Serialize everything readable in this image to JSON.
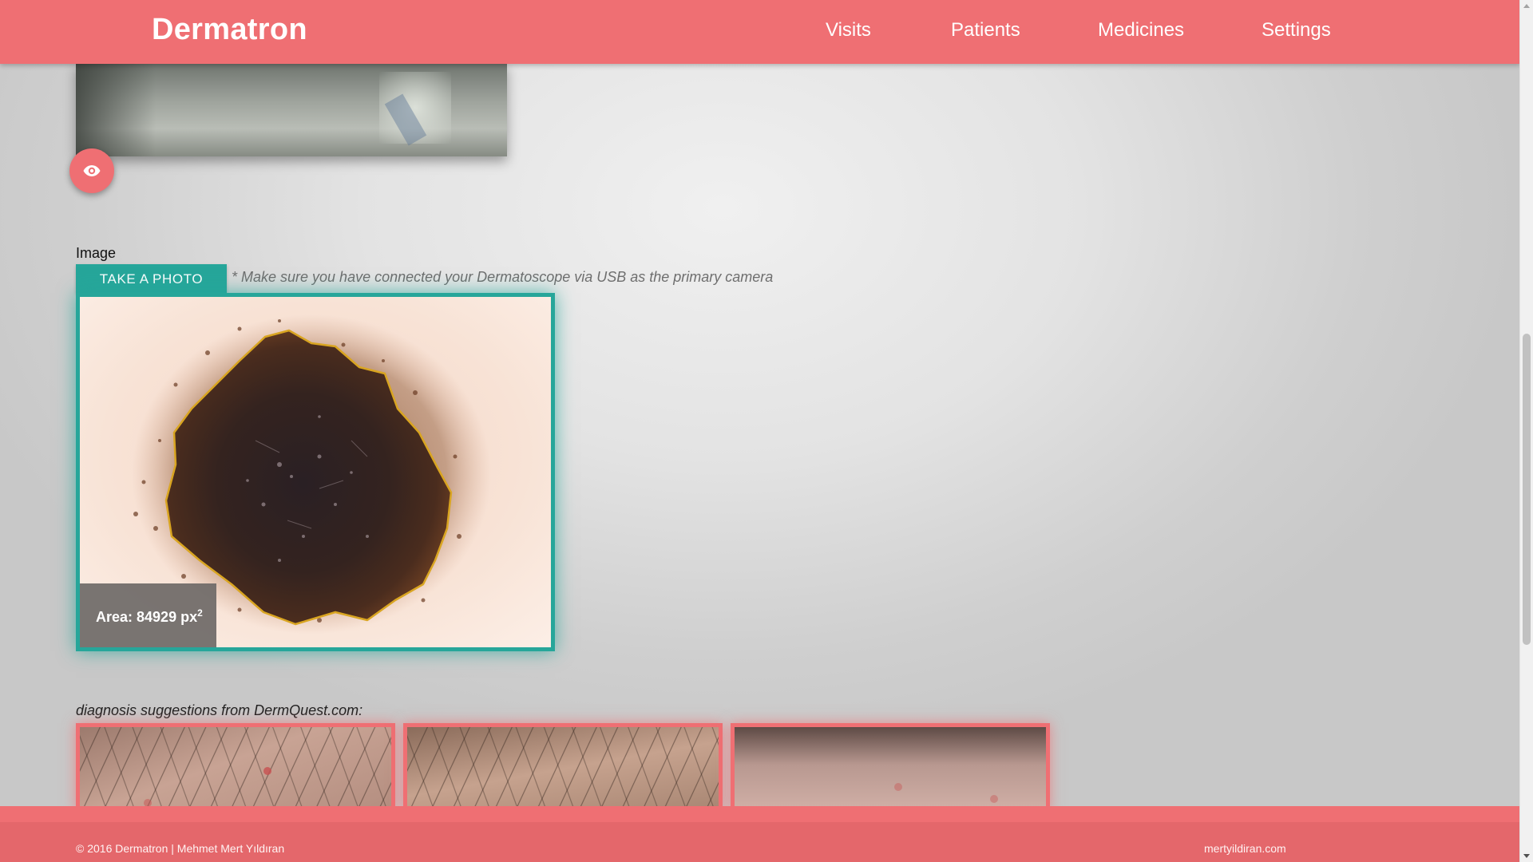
{
  "app": {
    "brand": "Dermatron"
  },
  "nav": {
    "items": [
      {
        "label": "Visits"
      },
      {
        "label": "Patients"
      },
      {
        "label": "Medicines"
      },
      {
        "label": "Settings"
      }
    ]
  },
  "icons": {
    "view": "eye-icon"
  },
  "image_section": {
    "label": "Image",
    "take_photo_label": "TAKE A PHOTO",
    "camera_note": "* Make sure you have connected your Dermatoscope via USB as the primary camera",
    "area_text": "Area: 84929 px",
    "area_exponent": "2"
  },
  "diagnosis": {
    "label": "diagnosis suggestions from DermQuest.com:",
    "suggestions_count_visible": 3
  },
  "footer": {
    "copyright": "© 2016 Dermatron | Mehmet Mert Yıldıran",
    "link": "mertyildiran.com"
  },
  "colors": {
    "primary": "#ef6f73",
    "accent": "#26a69a",
    "lesion_outline": "#d9a521"
  }
}
